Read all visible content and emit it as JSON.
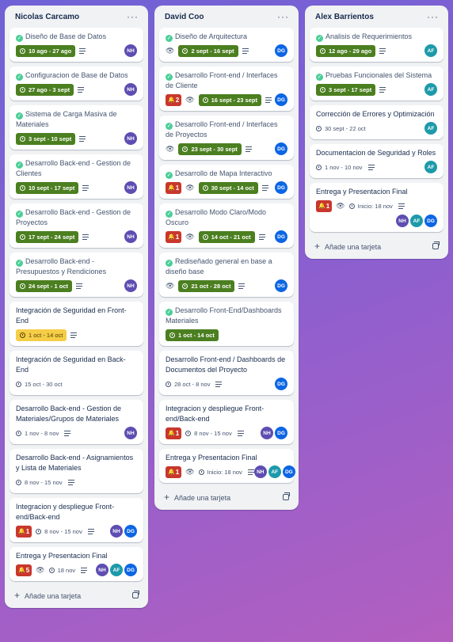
{
  "colors": {
    "completed_check": "#4bce97",
    "date_green": "#4b7f20",
    "date_yellow": "#f5cd47",
    "alert_red": "#c9372c",
    "NH": "#5e4db2",
    "AF": "#1d9aaa",
    "DG": "#0c66e4"
  },
  "add_card_label": "Añade una tarjeta",
  "lists": [
    {
      "title": "Nicolas Carcamo",
      "cards": [
        {
          "title": "Diseño de Base de Datos",
          "done": true,
          "alert": null,
          "watch": false,
          "date": "10 ago - 27 ago",
          "date_style": "green",
          "desc": true,
          "members": [
            "NH"
          ]
        },
        {
          "title": "Configuracion de Base de Datos",
          "done": true,
          "alert": null,
          "watch": false,
          "date": "27 ago - 3 sept",
          "date_style": "green",
          "desc": true,
          "members": [
            "NH"
          ]
        },
        {
          "title": "Sistema de Carga Masiva de Materiales",
          "done": true,
          "alert": null,
          "watch": false,
          "date": "3 sept - 10 sept",
          "date_style": "green",
          "desc": true,
          "members": [
            "NH"
          ]
        },
        {
          "title": "Desarrollo Back-end - Gestion de Clientes",
          "done": true,
          "alert": null,
          "watch": false,
          "date": "10 sept - 17 sept",
          "date_style": "green",
          "desc": true,
          "members": [
            "NH"
          ]
        },
        {
          "title": "Desarrollo Back-end - Gestion de Proyectos",
          "done": true,
          "alert": null,
          "watch": false,
          "date": "17 sept - 24 sept",
          "date_style": "green",
          "desc": true,
          "members": [
            "NH"
          ]
        },
        {
          "title": "Desarrollo Back-end - Presupuestos y Rendiciones",
          "done": true,
          "alert": null,
          "watch": false,
          "date": "24 sept - 1 oct",
          "date_style": "green",
          "desc": true,
          "members": [
            "NH"
          ]
        },
        {
          "title": "Integración de Seguridad en Front-End",
          "done": false,
          "alert": null,
          "watch": false,
          "date": "1 oct - 14 oct",
          "date_style": "yellow",
          "desc": true,
          "members": []
        },
        {
          "title": "Integración de Seguridad en Back-End",
          "done": false,
          "alert": null,
          "watch": false,
          "date": "15 oct - 30 oct",
          "date_style": "plain",
          "desc": false,
          "members": []
        },
        {
          "title": "Desarrollo Back-end - Gestion de Materiales/Grupos de Materiales",
          "done": false,
          "alert": null,
          "watch": false,
          "date": "1 nov - 8 nov",
          "date_style": "plain",
          "desc": true,
          "members": [
            "NH"
          ]
        },
        {
          "title": "Desarrollo Back-end - Asignamientos y Lista de Materiales",
          "done": false,
          "alert": null,
          "watch": false,
          "date": "8 nov - 15 nov",
          "date_style": "plain",
          "desc": true,
          "members": []
        },
        {
          "title": "Integracion y despliegue Front-end/Back-end",
          "done": false,
          "alert": "1",
          "watch": false,
          "date": "8 nov - 15 nov",
          "date_style": "plain",
          "desc": true,
          "members": [
            "NH",
            "DG"
          ]
        },
        {
          "title": "Entrega y Presentacion Final",
          "done": false,
          "alert": "5",
          "watch": true,
          "date": "18 nov",
          "date_style": "plain",
          "desc": true,
          "members": [
            "NH",
            "AF",
            "DG"
          ]
        }
      ]
    },
    {
      "title": "David Coo",
      "cards": [
        {
          "title": "Diseño de Arquitectura",
          "done": true,
          "alert": null,
          "watch": true,
          "date": "2 sept - 16 sept",
          "date_style": "green",
          "desc": true,
          "members": [
            "DG"
          ]
        },
        {
          "title": "Desarrollo Front-end / Interfaces de Cliente",
          "done": true,
          "alert": "2",
          "watch": true,
          "date": "16 sept - 23 sept",
          "date_style": "green",
          "desc": true,
          "members": [
            "DG"
          ]
        },
        {
          "title": "Desarrollo Front-end / Interfaces de Proyectos",
          "done": true,
          "alert": null,
          "watch": true,
          "date": "23 sept - 30 sept",
          "date_style": "green",
          "desc": true,
          "members": [
            "DG"
          ]
        },
        {
          "title": "Desarrollo de Mapa Interactivo",
          "done": true,
          "alert": "1",
          "watch": true,
          "date": "30 sept - 14 oct",
          "date_style": "green",
          "desc": true,
          "members": [
            "DG"
          ]
        },
        {
          "title": "Desarrollo Modo Claro/Modo Oscuro",
          "done": true,
          "alert": "1",
          "watch": true,
          "date": "14 oct - 21 oct",
          "date_style": "green",
          "desc": true,
          "members": [
            "DG"
          ]
        },
        {
          "title": "Rediseñado general en base a diseño base",
          "done": true,
          "alert": null,
          "watch": true,
          "date": "21 oct - 28 oct",
          "date_style": "green",
          "desc": true,
          "members": [
            "DG"
          ]
        },
        {
          "title": "Desarrollo Front-End/Dashboards Materiales",
          "done": true,
          "alert": null,
          "watch": false,
          "date": "1 oct - 14 oct",
          "date_style": "green",
          "desc": false,
          "members": []
        },
        {
          "title": "Desarrollo Front-end / Dashboards de Documentos del Proyecto",
          "done": false,
          "alert": null,
          "watch": false,
          "date": "28 oct - 8 nov",
          "date_style": "plain",
          "desc": true,
          "members": [
            "DG"
          ]
        },
        {
          "title": "Integracion y despliegue Front-end/Back-end",
          "done": false,
          "alert": "1",
          "watch": false,
          "date": "8 nov - 15 nov",
          "date_style": "plain",
          "desc": true,
          "members": [
            "NH",
            "DG"
          ]
        },
        {
          "title": "Entrega y Presentacion Final",
          "done": false,
          "alert": "1",
          "watch": true,
          "date": "Inicio: 18 nov",
          "date_style": "plain",
          "desc": true,
          "members": [
            "NH",
            "AF",
            "DG"
          ]
        }
      ]
    },
    {
      "title": "Alex Barrientos",
      "cards": [
        {
          "title": "Analisis de Requerimientos",
          "done": true,
          "alert": null,
          "watch": false,
          "date": "12 ago - 29 ago",
          "date_style": "green",
          "desc": true,
          "members": [
            "AF"
          ]
        },
        {
          "title": "Pruebas Funcionales del Sistema",
          "done": true,
          "alert": null,
          "watch": false,
          "date": "3 sept - 17 sept",
          "date_style": "green",
          "desc": true,
          "members": [
            "AF"
          ]
        },
        {
          "title": "Corrección de Errores y Optimización",
          "done": false,
          "alert": null,
          "watch": false,
          "date": "30 sept - 22 oct",
          "date_style": "plain",
          "desc": false,
          "members": [
            "AF"
          ]
        },
        {
          "title": "Documentacion de Seguridad y Roles",
          "done": false,
          "alert": null,
          "watch": false,
          "date": "1 nov - 10 nov",
          "date_style": "plain",
          "desc": true,
          "members": [
            "AF"
          ]
        },
        {
          "title": "Entrega y Presentacion Final",
          "done": false,
          "alert": "1",
          "watch": true,
          "date": "Inicio: 18 nov",
          "date_style": "plain",
          "desc": true,
          "members": [
            "NH",
            "AF",
            "DG"
          ],
          "members_below": true
        }
      ]
    }
  ]
}
